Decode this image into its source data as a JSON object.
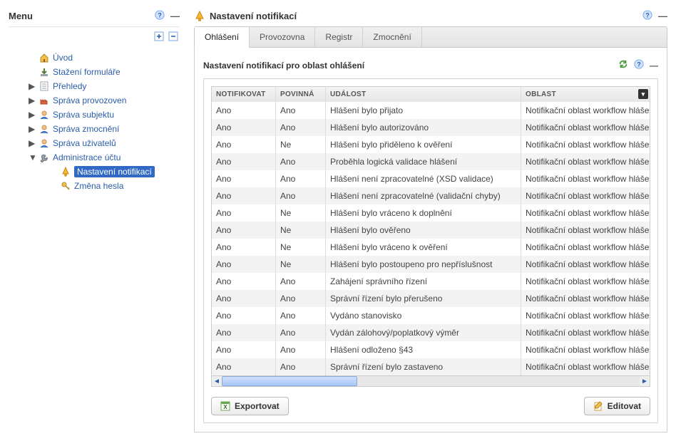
{
  "menu": {
    "title": "Menu",
    "items": [
      {
        "icon": "home",
        "label": "Úvod",
        "expandable": false
      },
      {
        "icon": "download",
        "label": "Stažení formuláře",
        "expandable": false
      },
      {
        "icon": "sheet",
        "label": "Přehledy",
        "expandable": true
      },
      {
        "icon": "factory",
        "label": "Správa provozoven",
        "expandable": true
      },
      {
        "icon": "user",
        "label": "Správa subjektu",
        "expandable": true
      },
      {
        "icon": "user",
        "label": "Správa zmocnění",
        "expandable": true
      },
      {
        "icon": "user",
        "label": "Správa uživatelů",
        "expandable": true
      },
      {
        "icon": "wrench",
        "label": "Administrace účtu",
        "expandable": true,
        "expanded": true,
        "children": [
          {
            "icon": "bell-orange",
            "label": "Nastavení notifikací",
            "selected": true
          },
          {
            "icon": "key",
            "label": "Změna hesla"
          }
        ]
      }
    ]
  },
  "pageTitle": "Nastavení notifikací",
  "tabs": [
    "Ohlášení",
    "Provozovna",
    "Registr",
    "Zmocnění"
  ],
  "activeTab": 0,
  "subTitle": "Nastavení notifikací pro oblast ohlášení",
  "table": {
    "headers": [
      "NOTIFIKOVAT",
      "POVINNÁ",
      "UDÁLOST",
      "OBLAST"
    ],
    "rows": [
      [
        "Ano",
        "Ano",
        "Hlášení bylo přijato",
        "Notifikační oblast workflow hláše"
      ],
      [
        "Ano",
        "Ano",
        "Hlášení bylo autorizováno",
        "Notifikační oblast workflow hláše"
      ],
      [
        "Ano",
        "Ne",
        "Hlášení bylo přiděleno k ověření",
        "Notifikační oblast workflow hláše"
      ],
      [
        "Ano",
        "Ano",
        "Proběhla logická validace hlášení",
        "Notifikační oblast workflow hláše"
      ],
      [
        "Ano",
        "Ano",
        "Hlášení není zpracovatelné (XSD validace)",
        "Notifikační oblast workflow hláše"
      ],
      [
        "Ano",
        "Ano",
        "Hlášení není zpracovatelné (validační chyby)",
        "Notifikační oblast workflow hláše"
      ],
      [
        "Ano",
        "Ne",
        "Hlášení bylo vráceno k doplnění",
        "Notifikační oblast workflow hláše"
      ],
      [
        "Ano",
        "Ne",
        "Hlášení bylo ověřeno",
        "Notifikační oblast workflow hláše"
      ],
      [
        "Ano",
        "Ne",
        "Hlášení bylo vráceno k ověření",
        "Notifikační oblast workflow hláše"
      ],
      [
        "Ano",
        "Ne",
        "Hlášení bylo postoupeno pro nepříslušnost",
        "Notifikační oblast workflow hláše"
      ],
      [
        "Ano",
        "Ano",
        "Zahájení správního řízení",
        "Notifikační oblast workflow hláše"
      ],
      [
        "Ano",
        "Ano",
        "Správní řízení bylo přerušeno",
        "Notifikační oblast workflow hláše"
      ],
      [
        "Ano",
        "Ano",
        "Vydáno stanovisko",
        "Notifikační oblast workflow hláše"
      ],
      [
        "Ano",
        "Ano",
        "Vydán zálohový/poplatkový výměr",
        "Notifikační oblast workflow hláše"
      ],
      [
        "Ano",
        "Ano",
        "Hlášení odloženo §43",
        "Notifikační oblast workflow hláše"
      ],
      [
        "Ano",
        "Ano",
        "Správní řízení bylo zastaveno",
        "Notifikační oblast workflow hláše"
      ]
    ]
  },
  "buttons": {
    "export": "Exportovat",
    "edit": "Editovat"
  }
}
